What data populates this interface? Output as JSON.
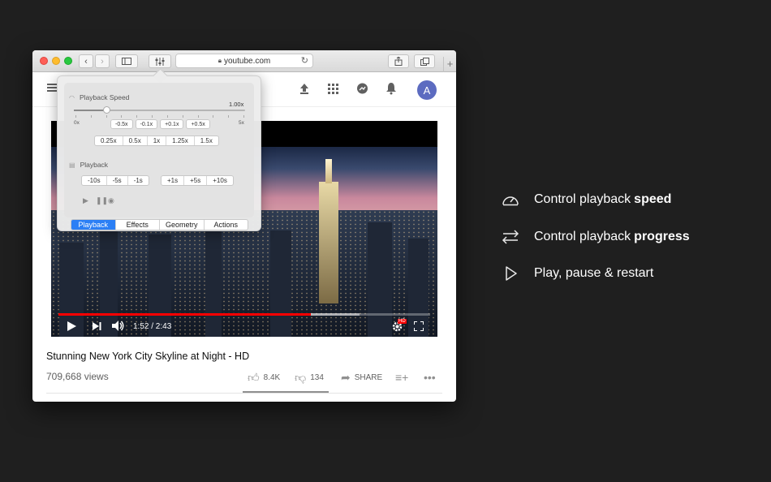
{
  "browser": {
    "url": "youtube.com",
    "new_tab_label": "+"
  },
  "youtube": {
    "avatar_initial": "A",
    "video": {
      "time": "1:52 / 2:43",
      "progress_fraction": 0.68,
      "buffered_fraction": 0.81,
      "hd_badge": "HD"
    },
    "title": "Stunning New York City Skyline at Night - HD",
    "views": "709,668 views",
    "likes": "8.4K",
    "dislikes": "134",
    "share_label": "SHARE"
  },
  "popover": {
    "speed_section_title": "Playback Speed",
    "speed_value": "1.00x",
    "speed_slider_fraction": 0.19,
    "slider_min_label": "0x",
    "slider_max_label": "5x",
    "speed_adjust_buttons": [
      "-0.5x",
      "-0.1x",
      "+0.1x",
      "+0.5x"
    ],
    "speed_presets": [
      "0.25x",
      "0.5x",
      "1x",
      "1.25x",
      "1.5x"
    ],
    "playback_section_title": "Playback",
    "seek_back_buttons": [
      "-10s",
      "-5s",
      "-1s"
    ],
    "seek_forward_buttons": [
      "+1s",
      "+5s",
      "+10s"
    ],
    "tabs": [
      "Playback",
      "Effects",
      "Geometry",
      "Actions"
    ],
    "active_tab": "Playback"
  },
  "features": [
    {
      "icon": "speedometer-icon",
      "text": "Control playback ",
      "bold": "speed"
    },
    {
      "icon": "arrows-exchange-icon",
      "text": "Control playback ",
      "bold": "progress"
    },
    {
      "icon": "play-outline-icon",
      "text": "Play, pause & restart",
      "bold": ""
    }
  ]
}
